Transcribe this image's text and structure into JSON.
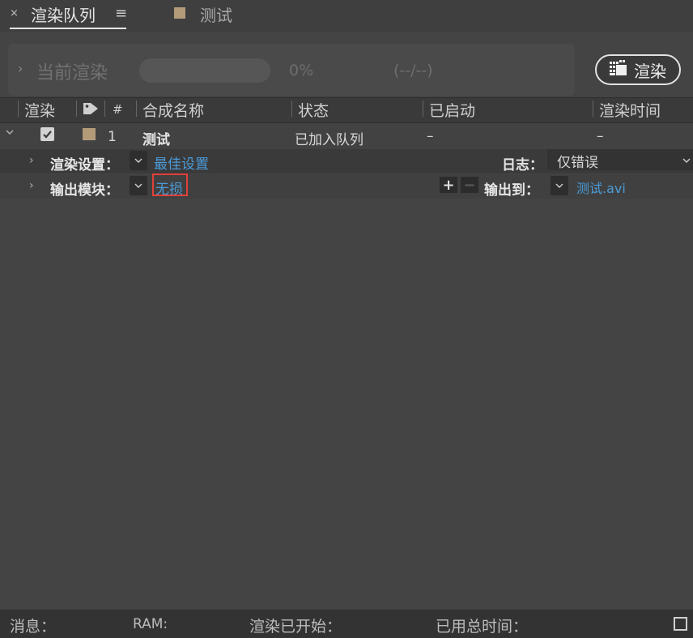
{
  "tabs": [
    {
      "close": "×",
      "title": "渲染队列",
      "menu": "≡"
    },
    {
      "title": "测试"
    }
  ],
  "status_panel": {
    "chevron": "›",
    "current_render_label": "当前渲染",
    "progress_percent": 0,
    "progress_text": "0%",
    "time_text": "(--/--)",
    "render_button_label": "渲染"
  },
  "columns": {
    "render": "渲染",
    "number": "#",
    "comp_name": "合成名称",
    "status": "状态",
    "started": "已启动",
    "render_time": "渲染时间"
  },
  "queue_item": {
    "checked": true,
    "label_color": "#b39b7a",
    "number": "1",
    "comp_name": "测试",
    "status": "已加入队列",
    "started": "–",
    "render_time": "–",
    "render_settings": {
      "label": "渲染设置：",
      "value": "最佳设置"
    },
    "log": {
      "label": "日志：",
      "value": "仅错误"
    },
    "output_module": {
      "label": "输出模块：",
      "value": "无损"
    },
    "output_to": {
      "label": "输出到：",
      "value": "测试.avi"
    }
  },
  "footer": {
    "message": "消息：",
    "ram": "RAM:",
    "render_started": "渲染已开始：",
    "total_time": "已用总时间："
  },
  "colors": {
    "highlight": "#e2403a",
    "link": "#4a9bd8"
  }
}
